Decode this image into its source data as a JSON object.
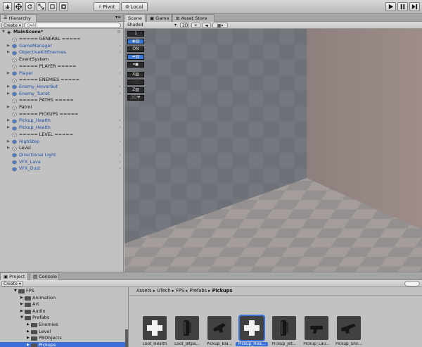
{
  "toolbar": {
    "tools": [
      "hand-icon",
      "move-icon",
      "rotate-icon",
      "scale-icon",
      "rect-icon",
      "transform-icon"
    ],
    "pivot_label": "Pivot",
    "local_label": "Local",
    "play": [
      "play-icon",
      "pause-icon",
      "step-icon"
    ]
  },
  "hierarchy": {
    "tab_label": "Hierarchy",
    "create_label": "Create",
    "search_placeholder": "Q▾All",
    "scene_name": "MainScene*",
    "items": [
      {
        "label": "===== GENERAL =====",
        "arrow": false,
        "prefab": false,
        "chevron": false
      },
      {
        "label": "GameManager",
        "arrow": true,
        "prefab": true,
        "chevron": true
      },
      {
        "label": "ObjectiveKillEnemies",
        "arrow": true,
        "prefab": true,
        "chevron": true
      },
      {
        "label": "EventSystem",
        "arrow": false,
        "prefab": false,
        "chevron": false
      },
      {
        "label": "===== PLAYER =====",
        "arrow": false,
        "prefab": false,
        "chevron": false
      },
      {
        "label": "Player",
        "arrow": true,
        "prefab": true,
        "chevron": true
      },
      {
        "label": "===== ENEMIES =====",
        "arrow": false,
        "prefab": false,
        "chevron": false
      },
      {
        "label": "Enemy_HoverBot",
        "arrow": true,
        "prefab": true,
        "chevron": true
      },
      {
        "label": "Enemy_Turret",
        "arrow": true,
        "prefab": true,
        "chevron": true
      },
      {
        "label": "===== PATHS =====",
        "arrow": false,
        "prefab": false,
        "chevron": false
      },
      {
        "label": "Patrol",
        "arrow": true,
        "prefab": false,
        "chevron": false
      },
      {
        "label": "===== PICKUPS =====",
        "arrow": false,
        "prefab": false,
        "chevron": false
      },
      {
        "label": "Pickup_Health",
        "arrow": true,
        "prefab": true,
        "chevron": true
      },
      {
        "label": "Pickup_Health",
        "arrow": true,
        "prefab": true,
        "chevron": true
      },
      {
        "label": "===== LEVEL =====",
        "arrow": false,
        "prefab": false,
        "chevron": false
      },
      {
        "label": "HighStep",
        "arrow": true,
        "prefab": true,
        "chevron": true
      },
      {
        "label": "Level",
        "arrow": true,
        "prefab": false,
        "chevron": false
      },
      {
        "label": "Directional Light",
        "arrow": false,
        "prefab": true,
        "chevron": true
      },
      {
        "label": "VFX_Lava",
        "arrow": false,
        "prefab": true,
        "chevron": true
      },
      {
        "label": "VFX_Dust",
        "arrow": false,
        "prefab": true,
        "chevron": true
      }
    ]
  },
  "scene": {
    "tabs": [
      "Scene",
      "Game",
      "Asset Store"
    ],
    "shading": "Shaded",
    "mode_2d": "2D",
    "gizmo_labels": [
      "1",
      "",
      "ON",
      "",
      "",
      "X",
      "Y",
      "Z",
      "3D"
    ]
  },
  "project": {
    "tabs": [
      "Project",
      "Console"
    ],
    "create_label": "Create",
    "breadcrumb": [
      "Assets",
      "UTech",
      "FPS",
      "Prefabs",
      "Pickups"
    ],
    "tree": [
      {
        "label": "FPS",
        "depth": 0,
        "expanded": true
      },
      {
        "label": "Animation",
        "depth": 1,
        "expanded": false
      },
      {
        "label": "Art",
        "depth": 1,
        "expanded": false
      },
      {
        "label": "Audio",
        "depth": 1,
        "expanded": false
      },
      {
        "label": "Prefabs",
        "depth": 1,
        "expanded": true
      },
      {
        "label": "Enemies",
        "depth": 2,
        "expanded": false
      },
      {
        "label": "Level",
        "depth": 2,
        "expanded": false
      },
      {
        "label": "PBObjects",
        "depth": 2,
        "expanded": false
      },
      {
        "label": "Pickups",
        "depth": 2,
        "expanded": false,
        "selected": true
      }
    ],
    "assets": [
      {
        "label": "Loot_Health",
        "kind": "cross"
      },
      {
        "label": "Loot_Jetpa...",
        "kind": "jetpack"
      },
      {
        "label": "Pickup_Bla...",
        "kind": "blaster"
      },
      {
        "label": "Pickup_Hea...",
        "kind": "cross",
        "selected": true
      },
      {
        "label": "Pickup_Jet...",
        "kind": "jetpack"
      },
      {
        "label": "Pickup_Lau...",
        "kind": "launcher"
      },
      {
        "label": "Pickup_Sho...",
        "kind": "shotgun"
      }
    ]
  },
  "colors": {
    "selection": "#3d6fd8",
    "prefab_text": "#1f4fa8",
    "panel": "#c2c2c2"
  }
}
